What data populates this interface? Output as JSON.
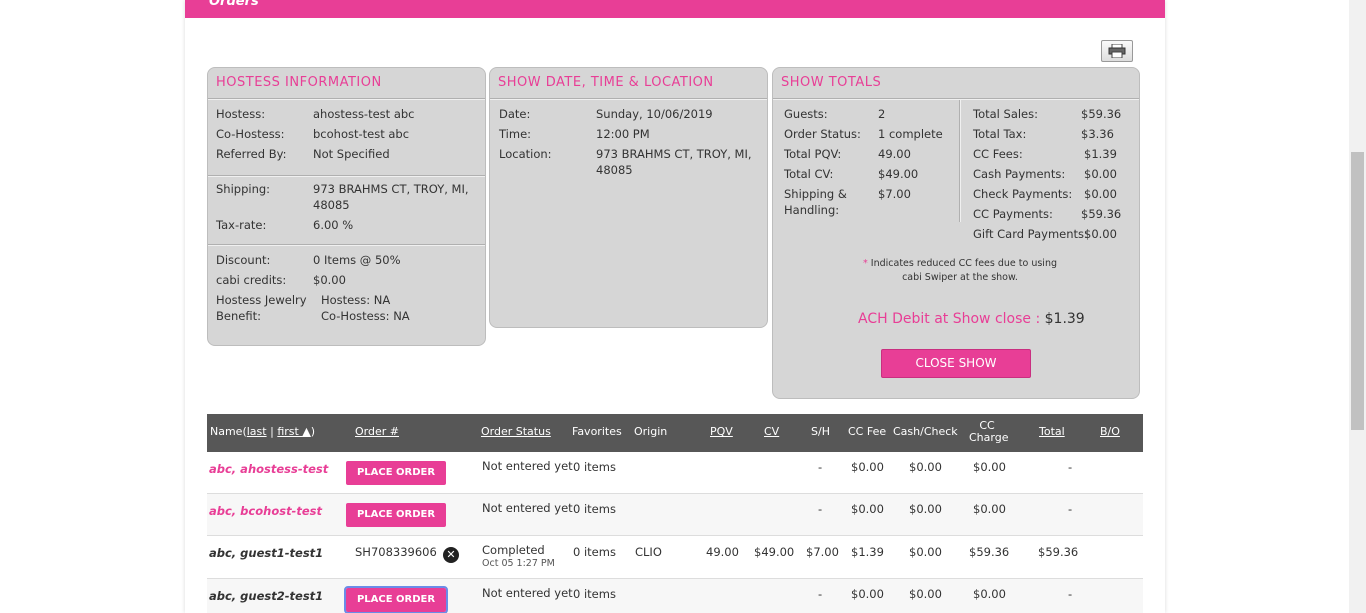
{
  "header": {
    "title": "Orders"
  },
  "hostess": {
    "title": "HOSTESS INFORMATION",
    "fields": [
      {
        "label": "Hostess:",
        "value": "ahostess-test abc"
      },
      {
        "label": "Co-Hostess:",
        "value": "bcohost-test abc"
      },
      {
        "label": "Referred By:",
        "value": "Not Specified"
      },
      {
        "label": "Shipping:",
        "value": "973 BRAHMS CT, TROY, MI,",
        "value2": "48085"
      },
      {
        "label": "Tax-rate:",
        "value": "6.00 %"
      },
      {
        "label": "Discount:",
        "value": "0 Items @ 50%"
      },
      {
        "label": "cabi credits:",
        "value": "$0.00"
      }
    ],
    "jewelry_label1": "Hostess Jewelry",
    "jewelry_label2": "Benefit:",
    "jewelry_hostess": "Hostess: NA",
    "jewelry_cohostess": "Co-Hostess: NA"
  },
  "show_info": {
    "title": "SHOW DATE, TIME & LOCATION",
    "date_label": "Date:",
    "date": "Sunday, 10/06/2019",
    "time_label": "Time:",
    "time": "12:00 PM",
    "location_label": "Location:",
    "location1": "973 BRAHMS CT, TROY, MI,",
    "location2": "48085"
  },
  "totals": {
    "title": "SHOW TOTALS",
    "left": [
      {
        "label": "Guests:",
        "value": "2"
      },
      {
        "label": "Order Status:",
        "value": "1 complete"
      },
      {
        "label": "Total PQV:",
        "value": "49.00"
      },
      {
        "label": "Total CV:",
        "value": "$49.00"
      },
      {
        "label": "Shipping &",
        "value": "$7.00"
      }
    ],
    "handling_label": "Handling:",
    "right": [
      {
        "label": "Total Sales:",
        "value": "$59.36"
      },
      {
        "label": "Total Tax:",
        "value": "$3.36"
      },
      {
        "label": "CC Fees:",
        "value": "$1.39"
      },
      {
        "label": "Cash Payments:",
        "value": "$0.00"
      },
      {
        "label": "Check Payments:",
        "value": "$0.00"
      },
      {
        "label": "CC Payments:",
        "value": "$59.36"
      },
      {
        "label": "Gift Card Payments:",
        "value": "$0.00"
      }
    ],
    "note_star": "*",
    "note1": "Indicates reduced CC fees due to using",
    "note2": "cabi Swiper at the show.",
    "ach_label": "ACH Debit at Show close :",
    "ach_value": "$1.39",
    "close_button": "CLOSE SHOW"
  },
  "table": {
    "headers": {
      "name": "Name(",
      "last": "last",
      "sep": "|",
      "first": "first ▲",
      "close": ")",
      "order": "Order #",
      "status": "Order Status",
      "favorites": "Favorites",
      "origin": "Origin",
      "pqv": "PQV",
      "cv": "CV",
      "sh": "S/H",
      "ccfee": "CC Fee",
      "cash": "Cash/Check",
      "cc1": "CC",
      "cc2": "Charge",
      "total": "Total",
      "bo": "B/O"
    },
    "rows": [
      {
        "name": "abc, ahostess-test",
        "button": "PLACE ORDER",
        "status": "Not entered yet",
        "favorites": "0 items",
        "sh": "-",
        "ccfee": "$0.00",
        "cash": "$0.00",
        "cc": "$0.00",
        "total": "-"
      },
      {
        "name": "abc, bcohost-test",
        "button": "PLACE ORDER",
        "status": "Not entered yet",
        "favorites": "0 items",
        "sh": "-",
        "ccfee": "$0.00",
        "cash": "$0.00",
        "cc": "$0.00",
        "total": "-"
      },
      {
        "name": "abc, guest1-test1",
        "order": "SH708339606",
        "status": "Completed",
        "status_date": "Oct 05 1:27 PM",
        "favorites": "0 items",
        "origin": "CLIO",
        "pqv": "49.00",
        "cv": "$49.00",
        "sh": "$7.00",
        "ccfee": "$1.39",
        "cash": "$0.00",
        "cc": "$59.36",
        "total": "$59.36"
      },
      {
        "name": "abc, guest2-test1",
        "button": "PLACE ORDER",
        "status": "Not entered yet",
        "favorites": "0 items",
        "sh": "-",
        "ccfee": "$0.00",
        "cash": "$0.00",
        "cc": "$0.00",
        "total": "-"
      }
    ]
  }
}
